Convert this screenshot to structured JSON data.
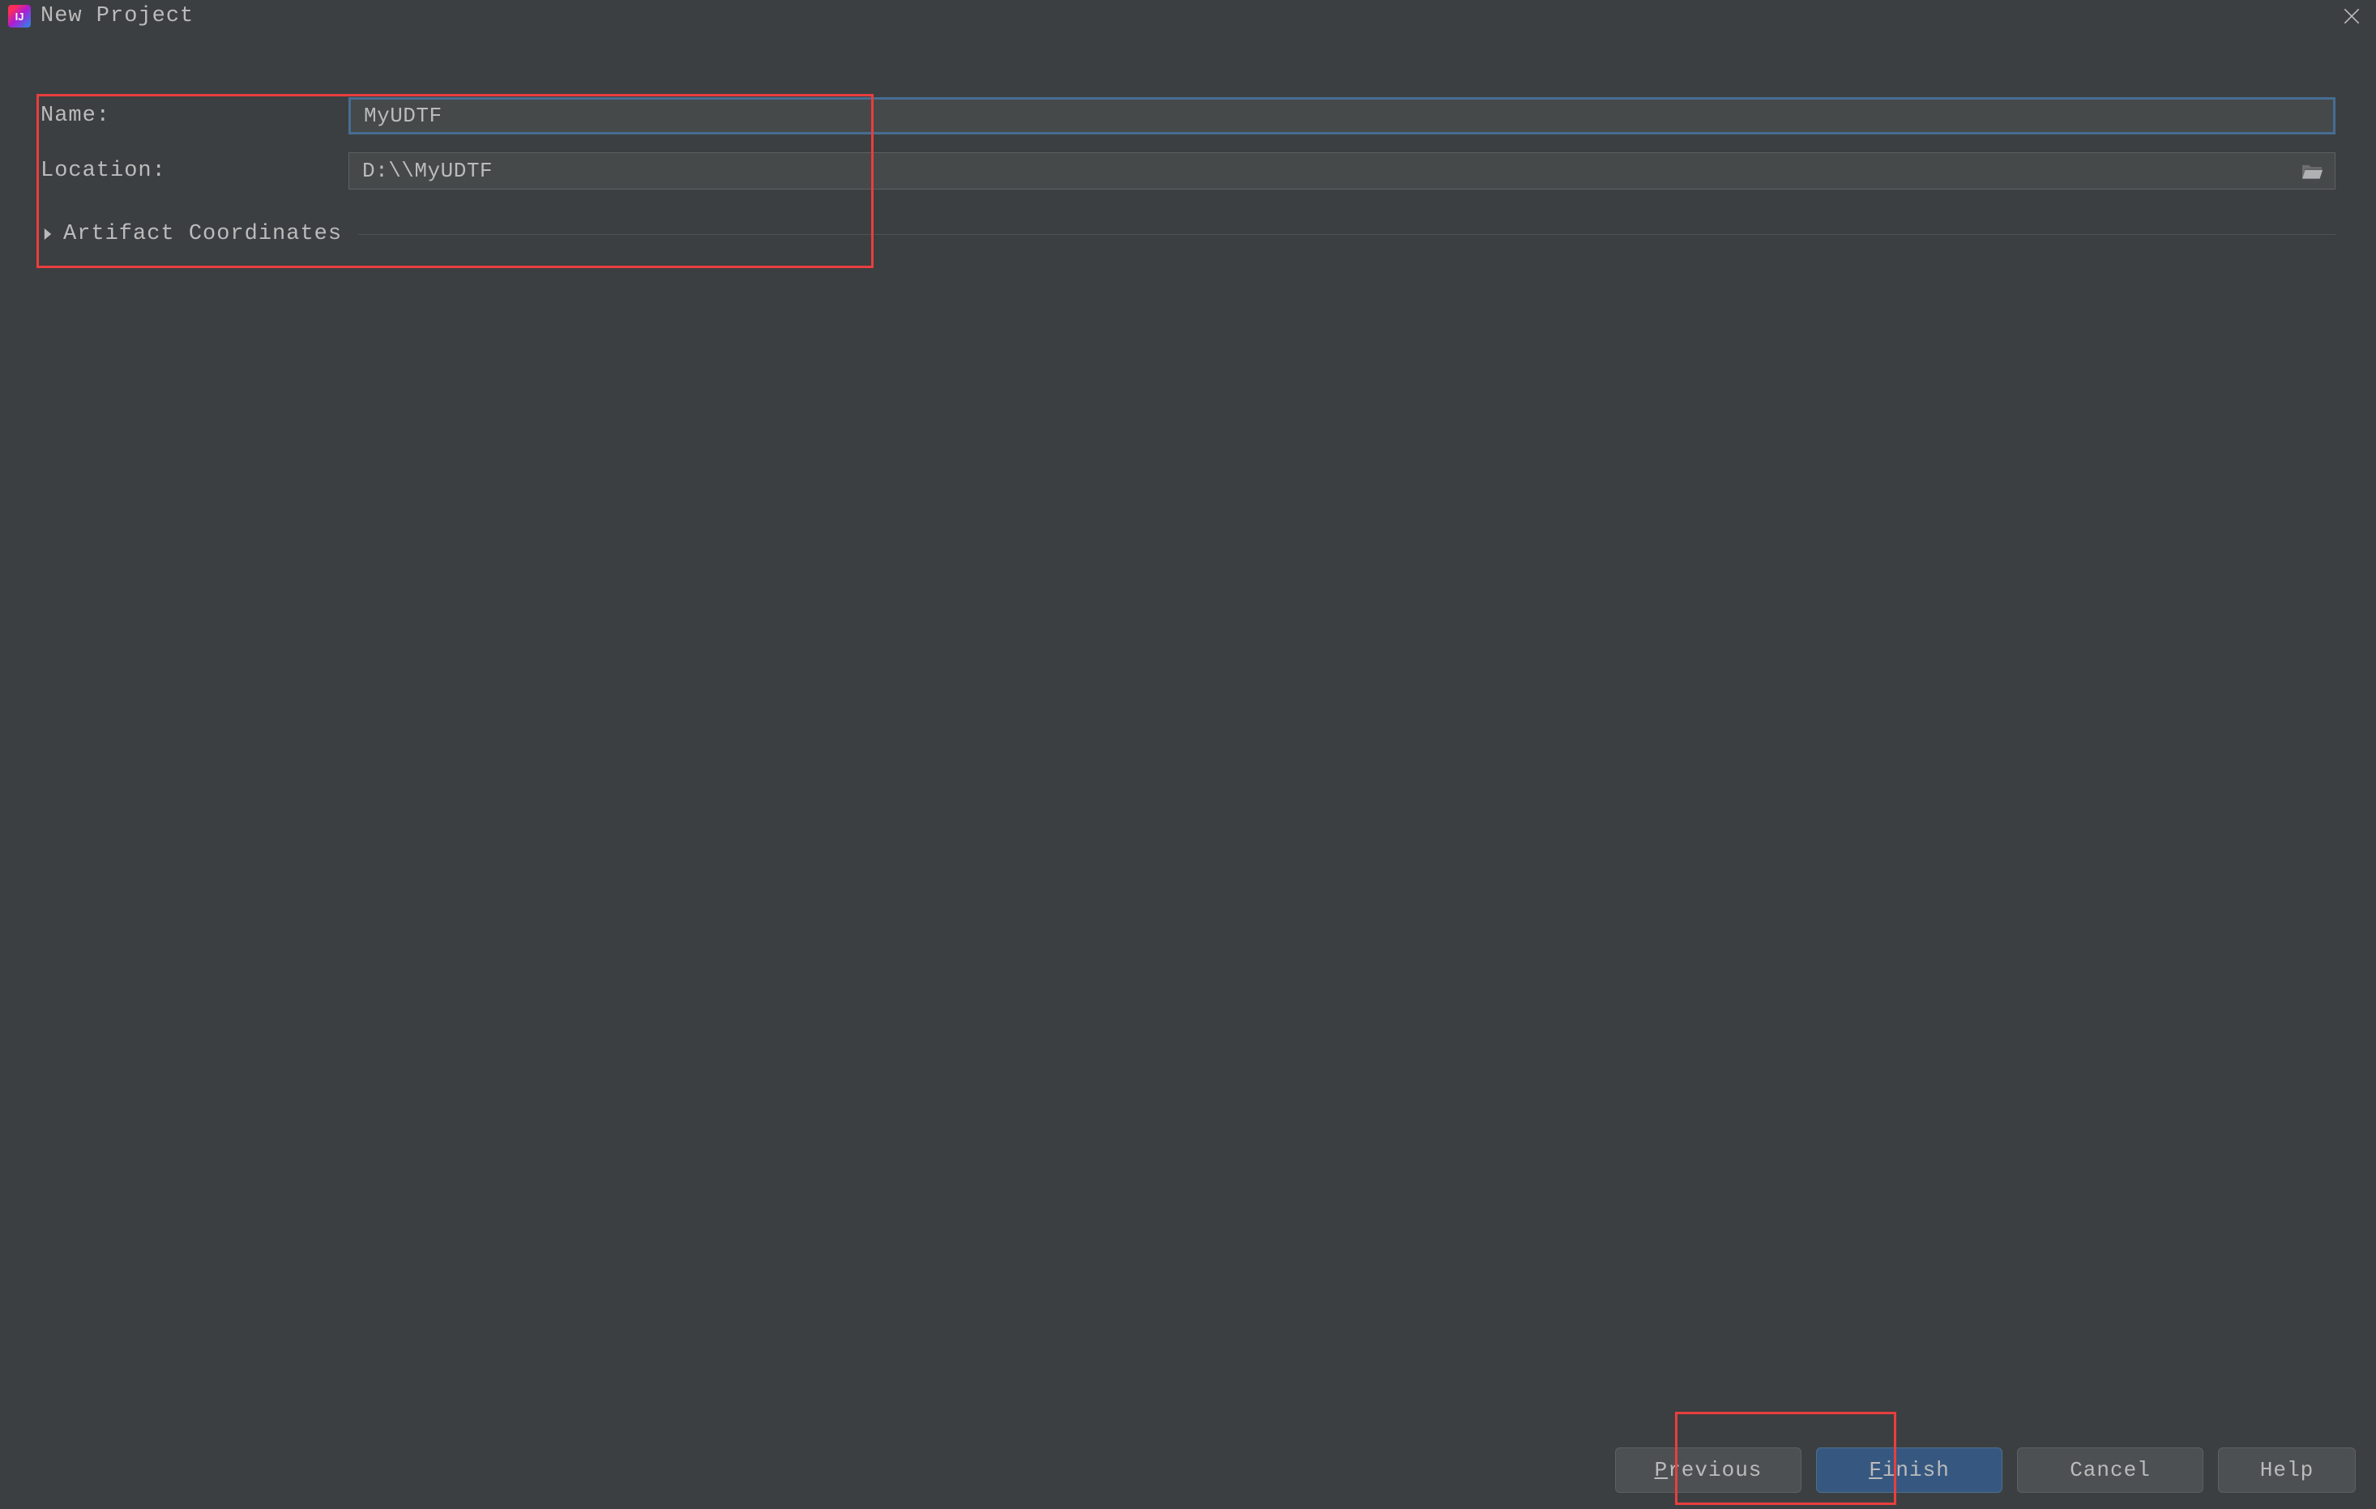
{
  "dialog": {
    "title": "New Project"
  },
  "form": {
    "name_label": "Name:",
    "name_value": "MyUDTF",
    "location_label": "Location:",
    "location_value": "D:\\\\MyUDTF"
  },
  "sections": {
    "artifact_coordinates": "Artifact Coordinates"
  },
  "buttons": {
    "previous": "revious",
    "previous_letter": "P",
    "finish": "inish",
    "finish_letter": "F",
    "cancel": "Cancel",
    "help": "Help"
  }
}
